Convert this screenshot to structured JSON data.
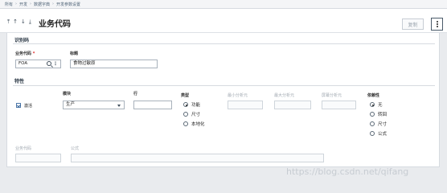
{
  "breadcrumbs": [
    "所有",
    "开发",
    "数据字典",
    "开发参数设置"
  ],
  "nav_icons": [
    "⤒",
    "↑",
    "↓",
    "⤓"
  ],
  "header": {
    "title": "业务代码",
    "copy_label": "复制"
  },
  "identification": {
    "section_title": "识别码",
    "business_code_label": "业务代码",
    "required_mark": "*",
    "business_code_value": "FOA",
    "title_label": "标题",
    "title_value": "食物过敏原"
  },
  "characteristics": {
    "section_title": "特性",
    "activate_label": "激活",
    "activate_checked": true,
    "module_label": "模块",
    "module_value": "生产",
    "row_label": "行",
    "type_label": "类型",
    "type_options": [
      "功能",
      "尺寸",
      "本地化"
    ],
    "type_selected": "功能",
    "min_fraction_label": "最小分析元",
    "max_fraction_label": "最大分析元",
    "screen_fraction_label": "屏幕分析元",
    "dependency_label": "依赖性",
    "dependency_options": [
      "无",
      "转回",
      "尺寸",
      "公式"
    ],
    "dependency_selected": "无"
  },
  "footer_fields": {
    "business_code_label": "业务代码",
    "formula_label": "公式"
  },
  "watermark": "https://blog.csdn.net/qifang",
  "colors": {
    "accent": "#2f5f95",
    "required": "#dd2222",
    "panel_bg": "#ffffff",
    "page_bg": "#e9ebee"
  }
}
